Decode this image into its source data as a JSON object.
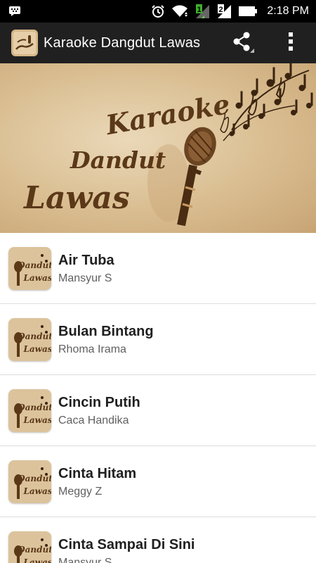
{
  "status_bar": {
    "time": "2:18 PM",
    "icons": [
      "bbm-icon",
      "alarm-icon",
      "wifi-icon",
      "signal-1-icon",
      "signal-2-icon",
      "battery-icon"
    ],
    "sim_labels": [
      "1",
      "2"
    ]
  },
  "action_bar": {
    "title": "Karaoke Dangdut Lawas",
    "icons": [
      "app-icon",
      "share-icon",
      "overflow-menu-icon"
    ]
  },
  "banner": {
    "line1": "Karaoke",
    "line2": "Dandut",
    "line3": "Lawas"
  },
  "songs": [
    {
      "title": "Air Tuba",
      "artist": "Mansyur S"
    },
    {
      "title": "Bulan Bintang",
      "artist": "Rhoma Irama"
    },
    {
      "title": "Cincin Putih",
      "artist": "Caca Handika"
    },
    {
      "title": "Cinta Hitam",
      "artist": "Meggy Z"
    },
    {
      "title": "Cinta Sampai Di Sini",
      "artist": "Mansyur S"
    }
  ],
  "thumbnail_text": {
    "line1": "Dandut",
    "line2": "Lawas"
  },
  "colors": {
    "status_bar_bg": "#000000",
    "action_bar_bg": "#202020",
    "banner_text": "#5a3818",
    "divider": "#dcdcdc"
  }
}
